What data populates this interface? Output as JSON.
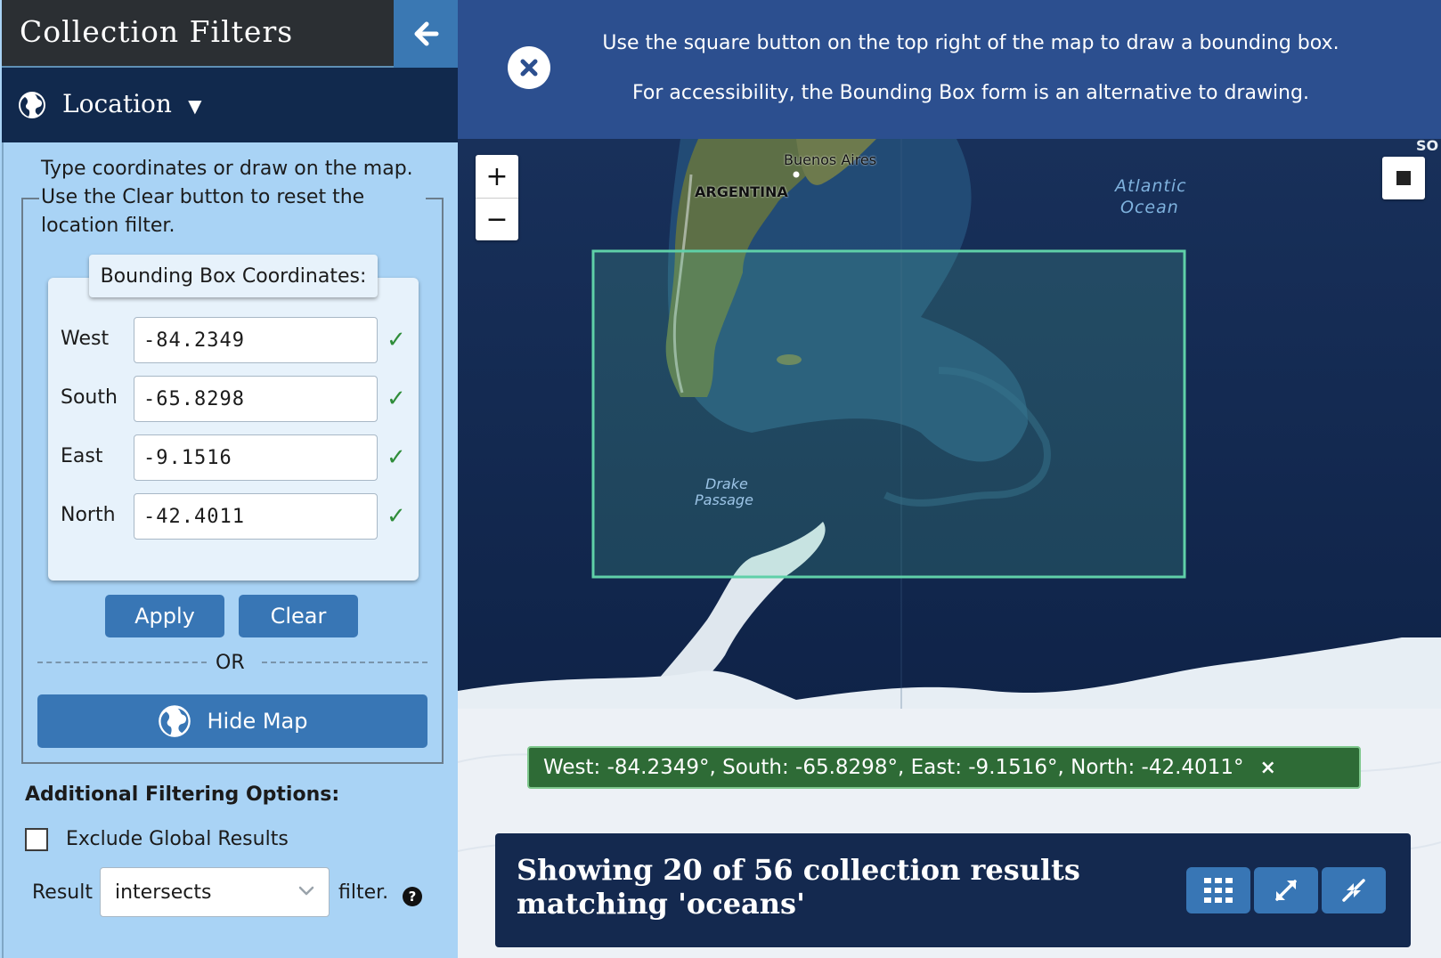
{
  "sidebar": {
    "title": "Collection Filters",
    "location_label": "Location",
    "instructions": "Type coordinates or draw on the map. Use the Clear button to reset the location filter.",
    "bbox_legend": "Bounding Box Coordinates:",
    "coords": [
      {
        "label": "West",
        "value": "-84.2349"
      },
      {
        "label": "South",
        "value": "-65.8298"
      },
      {
        "label": "East",
        "value": "-9.1516"
      },
      {
        "label": "North",
        "value": "-42.4011"
      }
    ],
    "apply_label": "Apply",
    "clear_label": "Clear",
    "or_label": "OR",
    "hide_map_label": "Hide Map",
    "additional_title": "Additional Filtering Options:",
    "exclude_global_label": "Exclude Global Results",
    "result_label": "Result",
    "result_select_value": "intersects",
    "filter_label": "filter."
  },
  "banner": {
    "line1": "Use the square button on the top right of the map to draw a bounding box.",
    "line2": "For accessibility, the Bounding Box form is an alternative to drawing."
  },
  "map": {
    "labels": {
      "buenos_aires": "Buenos Aires",
      "argentina": "ARGENTINA",
      "atlantic_line1": "Atlantic",
      "atlantic_line2": "Ocean",
      "drake_line1": "Drake",
      "drake_line2": "Passage",
      "edge_label": "SO"
    },
    "zoom_in": "+",
    "zoom_out": "−"
  },
  "coord_tag": {
    "text": "West: -84.2349°, South: -65.8298°, East: -9.1516°, North: -42.4011°",
    "close": "×"
  },
  "results": {
    "summary": "Showing 20 of 56 collection results matching 'oceans'"
  },
  "colors": {
    "sidebar_bg": "#a9d3f5",
    "header_bg": "#2b2f33",
    "location_bg": "#11294d",
    "button_blue": "#3876b5",
    "banner_bg": "#2c4f8f",
    "bbox_stroke": "#5fd0a8",
    "tag_bg": "#2e6b36",
    "results_bg": "#14294f"
  }
}
